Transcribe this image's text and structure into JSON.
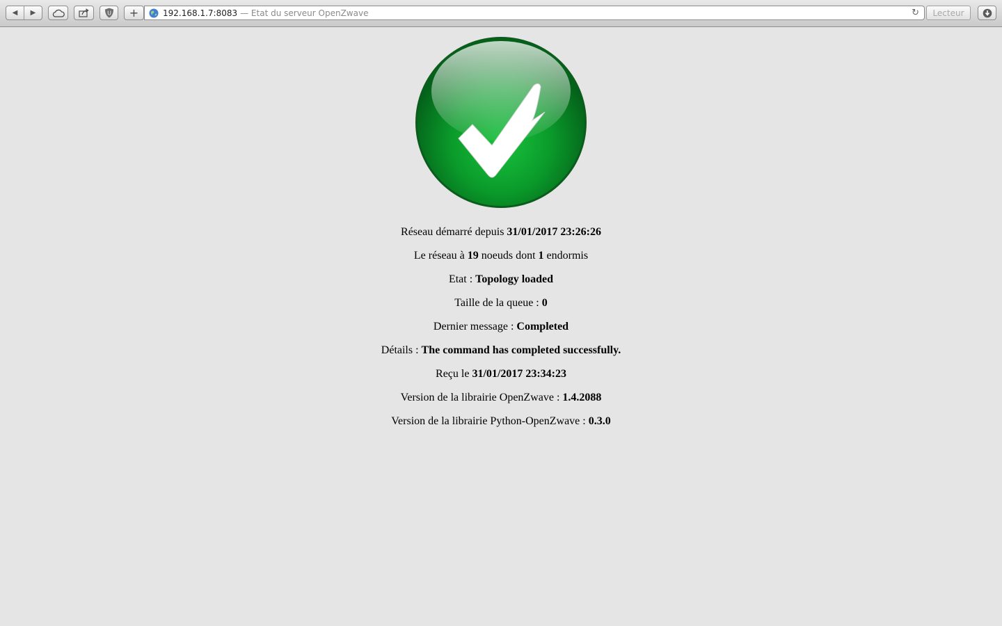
{
  "browser": {
    "url": "192.168.1.7:8083",
    "page_title": "— Etat du serveur OpenZwave",
    "reader_label": "Lecteur",
    "icons": {
      "back": "back-arrow-icon",
      "forward": "forward-arrow-icon",
      "cloud": "icloud-tabs-icon",
      "share": "share-icon",
      "extension": "ublock-icon",
      "new_tab": "plus-icon",
      "site": "globe-icon",
      "reload": "reload-icon",
      "download": "download-icon"
    }
  },
  "status": {
    "icon": "success-checkmark-icon",
    "color": "#0a9a2a",
    "lines": [
      {
        "label": "Réseau démarré depuis ",
        "value": "31/01/2017 23:26:26",
        "suffix": ""
      },
      {
        "label": "Le réseau à ",
        "value": "19",
        "mid": " noeuds dont ",
        "value2": "1",
        "suffix": " endormis"
      },
      {
        "label": "Etat : ",
        "value": "Topology loaded",
        "suffix": ""
      },
      {
        "label": "Taille de la queue : ",
        "value": "0",
        "suffix": ""
      },
      {
        "label": "Dernier message : ",
        "value": "Completed",
        "suffix": ""
      },
      {
        "label": "Détails : ",
        "value": "The command has completed successfully.",
        "suffix": ""
      },
      {
        "label": "Reçu le ",
        "value": "31/01/2017 23:34:23",
        "suffix": ""
      },
      {
        "label": "Version de la librairie OpenZwave : ",
        "value": "1.4.2088",
        "suffix": ""
      },
      {
        "label": "Version de la librairie Python-OpenZwave : ",
        "value": "0.3.0",
        "suffix": ""
      }
    ]
  }
}
